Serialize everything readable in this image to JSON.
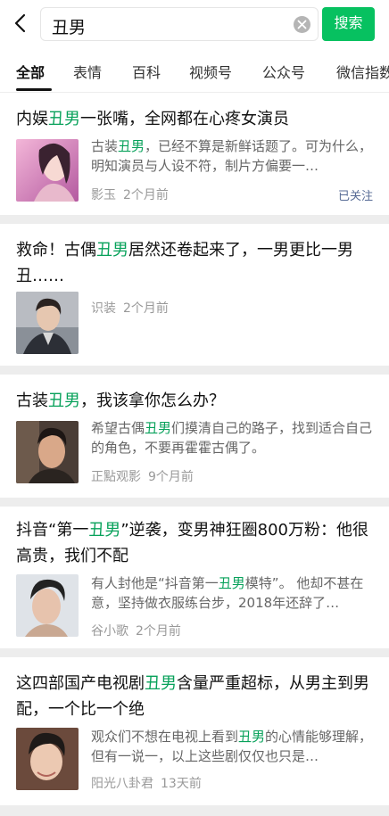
{
  "search": {
    "query": "丑男",
    "button": "搜索"
  },
  "tabs": [
    "全部",
    "表情",
    "百科",
    "视频号",
    "公众号",
    "微信指数"
  ],
  "results": [
    {
      "title_pre": "内娱",
      "title_hl": "丑男",
      "title_post": "一张嘴，全网都在心疼女演员",
      "snippet_pre": "古装",
      "snippet_hl": "丑男",
      "snippet_post": "，已经不算是新鲜话题了。可为什么，明知演员与人设不符，制片方偏要一…",
      "source": "影玉",
      "time": "2个月前",
      "followed": "已关注"
    },
    {
      "title_pre": "救命！古偶",
      "title_hl": "丑男",
      "title_post": "居然还卷起来了，一男更比一男丑……",
      "source": "识装",
      "time": "2个月前"
    },
    {
      "title_pre": "古装",
      "title_hl": "丑男",
      "title_post": "，我该拿你怎么办？",
      "snippet_pre": "希望古偶",
      "snippet_hl": "丑男",
      "snippet_post": "们摸清自己的路子，找到适合自己的角色，不要再霍霍古偶了。",
      "source": "正點观影",
      "time": "9个月前"
    },
    {
      "title_pre": "抖音“第一",
      "title_hl": "丑男",
      "title_post": "”逆袭，变男神狂圈800万粉：他很高贵，我们不配",
      "snippet_pre": "有人封他是“抖音第一",
      "snippet_hl": "丑男",
      "snippet_post": "模特”。 他却不甚在意，坚持做衣服练台步，2018年还辞了…",
      "source": "谷小歌",
      "time": "2个月前"
    },
    {
      "title_pre": "这四部国产电视剧",
      "title_hl": "丑男",
      "title_post": "含量严重超标，从男主到男配，一个比一个绝",
      "snippet_pre": "观众们不想在电视上看到",
      "snippet_hl": "丑男",
      "snippet_post": "的心情能够理解，但有一说一，以上这些剧仅仅也只是…",
      "source": "阳光八卦君",
      "time": "13天前"
    }
  ],
  "colors": {
    "accent": "#07c160",
    "highlight": "#07a15a",
    "follow": "#576b95"
  },
  "icons": {
    "back": "chevron-left-icon",
    "clear": "clear-circle-icon"
  }
}
